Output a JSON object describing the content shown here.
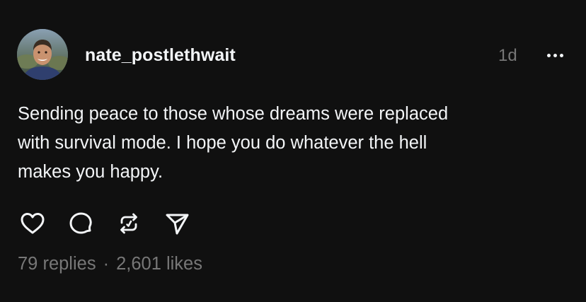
{
  "post": {
    "author": {
      "username": "nate_postlethwait",
      "avatar_icon": "profile-photo"
    },
    "timestamp": "1d",
    "more_icon": "more-horizontal-icon",
    "text": "Sending peace to those whose dreams were replaced\nwith survival mode. I hope you do whatever the hell\nmakes you happy.",
    "actions": [
      {
        "name": "like",
        "icon": "heart-icon"
      },
      {
        "name": "reply",
        "icon": "comment-icon"
      },
      {
        "name": "repost",
        "icon": "repost-icon"
      },
      {
        "name": "share",
        "icon": "send-icon"
      }
    ],
    "stats": {
      "replies": "79 replies",
      "separator": "·",
      "likes": "2,601 likes"
    }
  },
  "colors": {
    "background": "#101010",
    "text_primary": "#f3f5f7",
    "text_secondary": "#777777"
  }
}
